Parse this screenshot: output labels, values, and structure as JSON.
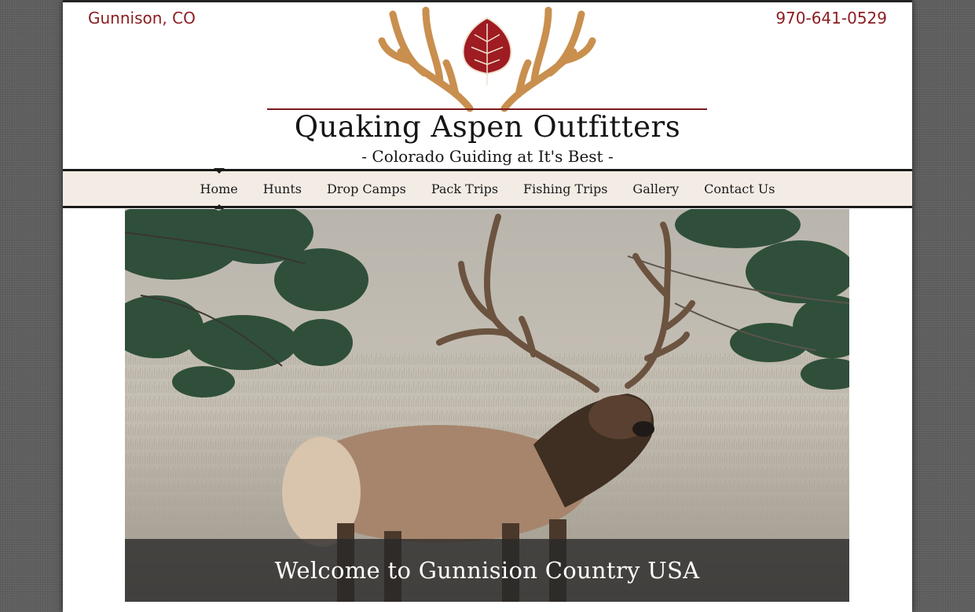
{
  "header": {
    "location": "Gunnison, CO",
    "phone": "970-641-0529",
    "site_title": "Quaking Aspen Outfitters",
    "tagline": "- Colorado Guiding at It's Best -",
    "logo_icon": "antler-aspen-leaf-logo"
  },
  "nav": {
    "items": [
      {
        "label": "Home",
        "active": true
      },
      {
        "label": "Hunts"
      },
      {
        "label": "Drop Camps"
      },
      {
        "label": "Pack Trips"
      },
      {
        "label": "Fishing Trips"
      },
      {
        "label": "Gallery"
      },
      {
        "label": "Contact Us"
      }
    ]
  },
  "hero": {
    "image": "bull-elk-in-meadow",
    "caption": "Welcome to Gunnision Country USA"
  },
  "colors": {
    "accent": "#8b1e23",
    "antler": "#c98f4e",
    "nav_bg": "#f3ece4"
  }
}
